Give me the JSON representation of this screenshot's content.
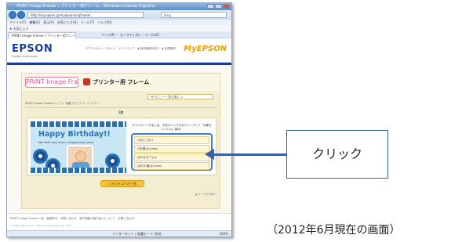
{
  "browser": {
    "window_title": "PRINT Image Framer / プリンター用フレーム - Windows Internet Explorer",
    "address": "http://my.epson.jp/myepson/inqframe/...",
    "search_placeholder": "Bing",
    "menu": "ファイル(F)　編集(E)　表示(V)　お気に入り(A)　ツール(T)　ヘルプ(H)",
    "favorites": "お気に入り",
    "tab_label": "PRINT Image Framer / プリンター用フレーム",
    "tab_tools": "ページ(P) ・ セーフティ(S) ・ ツール(O) ・",
    "status": "インターネット | 保護モード: 有効",
    "zoom": "100%"
  },
  "site": {
    "logo": "EPSON",
    "tagline": "EXCEED YOUR VISION",
    "header_links": "エプソンのトップページ　サイトマップ　▮ 製品情報を探す　▮ 会員登録",
    "myepson": "MyEPSON"
  },
  "pif": {
    "logo": "PRINT Image Framer",
    "title": "プリンター用 フレーム",
    "menu_select": "PIFメニュー一覧を選ぶ ->",
    "breadcrumb": "PRINT Image Framerトップ > 特集グラビア > バースデー",
    "section_heading": "1枚",
    "bday_title": "Happy Birthday!!",
    "bday_sub": "We wish you have a happy time year",
    "dl_text": "ダウンロードするには、下記のリンクを右クリックして「対象をファイルに保存」",
    "dl_items": [
      "L判(たて)(L)",
      "L判(横)(L)(new)",
      "はがき(たて)(L)",
      "はがき(横)(L)(new)"
    ],
    "list_button": "このカテゴリの一覧",
    "pagetop": "▲ページの先頭へ"
  },
  "footer": {
    "links": "PRINT Image Framer一覧　使用許可　お問い合わせ　個人情報の取り扱いについて　お問い合わせ",
    "copyright": "© Seiko Epson Corp. / Epson Sales Japan Corp. 2012"
  },
  "annotation": {
    "callout": "クリック",
    "caption": "（2012年6月現在の画面）"
  },
  "colors": {
    "epson_blue": "#1a3a9c",
    "callout_border": "#3b5ea8",
    "highlight_border": "#3d7fc4",
    "bday_text": "#1f78c1"
  }
}
